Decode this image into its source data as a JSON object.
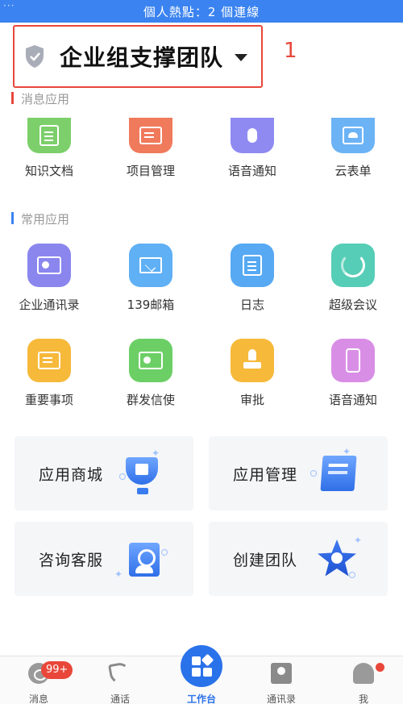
{
  "status_bar": {
    "text": "個人熱點：2 個連線",
    "left_text": "···"
  },
  "header": {
    "team_name": "企业组支撑团队",
    "annotation": "1"
  },
  "sections": {
    "messages_title": "消息应用",
    "common_title": "常用应用"
  },
  "message_apps": [
    {
      "label": "知识文档",
      "icon": "document-icon",
      "color": "#7ccf6a"
    },
    {
      "label": "项目管理",
      "icon": "project-icon",
      "color": "#f07a5c"
    },
    {
      "label": "语音通知",
      "icon": "microphone-icon",
      "color": "#8f8af2"
    },
    {
      "label": "云表单",
      "icon": "cloud-form-icon",
      "color": "#6cb3f5"
    }
  ],
  "common_apps": [
    {
      "label": "企业通讯录",
      "icon": "contact-book-icon",
      "color": "#8a86ee"
    },
    {
      "label": "139邮箱",
      "icon": "mail-icon",
      "color": "#5fb0f5"
    },
    {
      "label": "日志",
      "icon": "log-icon",
      "color": "#56a9f2"
    },
    {
      "label": "超级会议",
      "icon": "meeting-icon",
      "color": "#56cdb6"
    },
    {
      "label": "重要事项",
      "icon": "important-icon",
      "color": "#f6b93a"
    },
    {
      "label": "群发信使",
      "icon": "broadcast-icon",
      "color": "#6ccf66"
    },
    {
      "label": "审批",
      "icon": "approval-stamp-icon",
      "color": "#f6b93a"
    },
    {
      "label": "语音通知",
      "icon": "phone-voice-icon",
      "color": "#d98ee6"
    }
  ],
  "tiles": [
    {
      "label": "应用商城",
      "icon": "app-store-icon"
    },
    {
      "label": "应用管理",
      "icon": "app-manage-icon"
    },
    {
      "label": "咨询客服",
      "icon": "customer-service-icon"
    },
    {
      "label": "创建团队",
      "icon": "create-team-icon"
    }
  ],
  "tabbar": {
    "messages": "消息",
    "messages_badge": "99+",
    "calls": "通话",
    "workbench": "工作台",
    "contacts": "通讯录",
    "me": "我"
  },
  "colors": {
    "accent": "#2a72ea",
    "annotation": "#e8473a",
    "status_bar": "#3a83f0"
  }
}
